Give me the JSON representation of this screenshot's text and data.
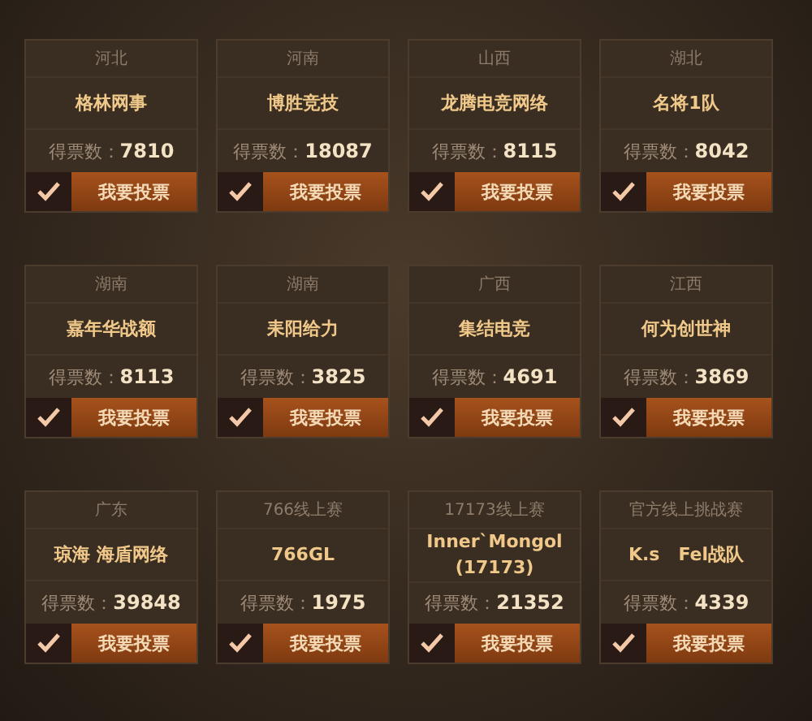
{
  "teams": [
    {
      "region": "河北",
      "name": "格林网事",
      "votes": "得票数：**7810**",
      "button": "我要投票"
    },
    {
      "region": "河南",
      "name": "博胜竞技",
      "votes": "得票数：**18087**",
      "button": "我要投票"
    },
    {
      "region": "山西",
      "name": "龙腾电竞网络",
      "votes": "得票数：**8115**",
      "button": "我要投票"
    },
    {
      "region": "湖北",
      "name": "名将1队",
      "votes": "得票数：**8042**",
      "button": "我要投票"
    },
    {
      "region": "湖南",
      "name": "嘉年华战额",
      "votes": "得票数：**8113**",
      "button": "我要投票"
    },
    {
      "region": "湖南",
      "name": "耒阳给力",
      "votes": "得票数：**3825**",
      "button": "我要投票"
    },
    {
      "region": "广西",
      "name": "集结电竞",
      "votes": "得票数：**4691**",
      "button": "我要投票"
    },
    {
      "region": "江西",
      "name": "何为创世神",
      "votes": "得票数：**3869**",
      "button": "我要投票"
    },
    {
      "region": "广东",
      "name": "琼海 海盾网络",
      "votes": "得票数：**39848**",
      "button": "我要投票"
    },
    {
      "region": "766线上赛",
      "name": "766GL",
      "votes": "得票数：**1975**",
      "button": "我要投票"
    },
    {
      "region": "17173线上赛",
      "name": "Inner`Mongol (17173)",
      "votes": "得票数：**21352**",
      "button": "我要投票"
    },
    {
      "region": "官方线上挑战赛",
      "name": "K.s   Fel战队",
      "votes": "得票数：**4339**",
      "button": "我要投票"
    }
  ]
}
